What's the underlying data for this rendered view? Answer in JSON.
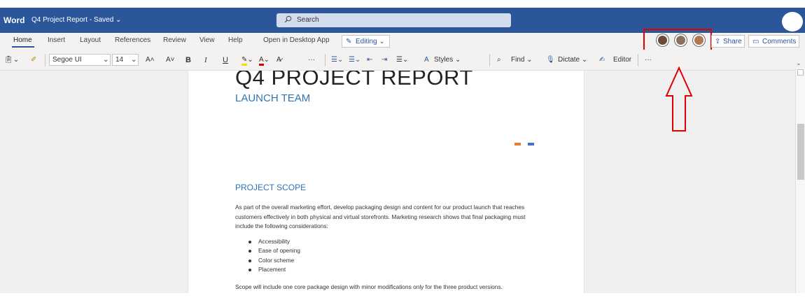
{
  "titlebar": {
    "app_name": "Word",
    "document_title": "Q4 Project Report - Saved ⌄",
    "search_placeholder": "Search"
  },
  "ribbon": {
    "tabs": [
      "Home",
      "Insert",
      "Layout",
      "References",
      "Review",
      "View",
      "Help",
      "Open in Desktop App"
    ],
    "editing_mode": "Editing ⌄",
    "share_label": "Share",
    "comments_label": "Comments"
  },
  "toolbar": {
    "font_name": "Segoe UI",
    "font_size": "14",
    "increase_font": "A˄",
    "decrease_font": "A˅",
    "bold": "B",
    "italic": "I",
    "underline": "U",
    "more": "···",
    "styles_label": "Styles ⌄",
    "find_label": "Find ⌄",
    "dictate_label": "Dictate ⌄",
    "editor_label": "Editor",
    "overflow": "···"
  },
  "document": {
    "title": "Q4 PROJECT REPORT",
    "subtitle": "LAUNCH TEAM",
    "section_heading": "PROJECT SCOPE",
    "paragraph1": "As part of the overall marketing effort, develop packaging design and content for our product launch that reaches customers effectively in both physical and virtual storefronts. Marketing research shows that final packaging must include the following considerations:",
    "bullets": [
      "Accessibility",
      "Ease of opening",
      "Color scheme",
      "Placement"
    ],
    "paragraph2": "Scope will include one core package design with minor modifications only for the three product versions."
  },
  "colors": {
    "brand": "#2b579a",
    "annotation": "#e00000",
    "heading": "#2e74b5",
    "accent_orange": "#ed7d31",
    "accent_blue": "#4472c4"
  },
  "icons": [
    "search-icon",
    "paste-icon",
    "format-painter-icon",
    "highlight-icon",
    "font-color-icon",
    "bullets-icon",
    "numbering-icon",
    "decrease-indent-icon",
    "increase-indent-icon",
    "align-icon",
    "styles-icon",
    "find-icon",
    "dictate-icon",
    "editor-icon",
    "share-icon",
    "comments-icon",
    "pencil-icon",
    "up-arrow-annotation-icon"
  ]
}
